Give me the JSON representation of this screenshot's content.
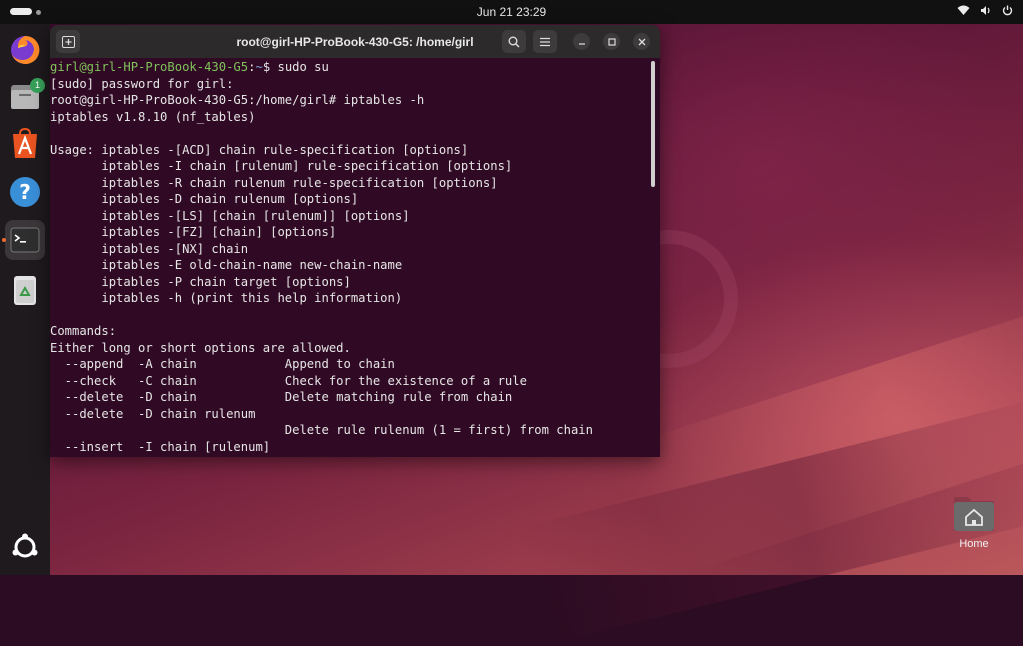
{
  "topbar": {
    "clock": "Jun 21  23:29",
    "icons": [
      "wifi-icon",
      "volume-icon",
      "power-icon"
    ]
  },
  "dock": {
    "items": [
      {
        "name": "firefox",
        "icon": "firefox-icon"
      },
      {
        "name": "files",
        "icon": "files-icon",
        "badge": "1"
      },
      {
        "name": "app-center",
        "icon": "app-center-icon"
      },
      {
        "name": "help",
        "icon": "help-icon"
      },
      {
        "name": "terminal",
        "icon": "terminal-icon",
        "active": true
      },
      {
        "name": "trash",
        "icon": "trash-icon"
      }
    ],
    "show_apps_icon": "ubuntu-logo-icon"
  },
  "terminal": {
    "title": "root@girl-HP-ProBook-430-G5: /home/girl",
    "prompt_user": "girl@girl-HP-ProBook-430-G5",
    "prompt_sep": ":",
    "prompt_path": "~",
    "prompt_cmd": "$ sudo su",
    "lines": [
      "[sudo] password for girl:",
      "root@girl-HP-ProBook-430-G5:/home/girl# iptables -h",
      "iptables v1.8.10 (nf_tables)",
      "",
      "Usage: iptables -[ACD] chain rule-specification [options]",
      "       iptables -I chain [rulenum] rule-specification [options]",
      "       iptables -R chain rulenum rule-specification [options]",
      "       iptables -D chain rulenum [options]",
      "       iptables -[LS] [chain [rulenum]] [options]",
      "       iptables -[FZ] [chain] [options]",
      "       iptables -[NX] chain",
      "       iptables -E old-chain-name new-chain-name",
      "       iptables -P chain target [options]",
      "       iptables -h (print this help information)",
      "",
      "Commands:",
      "Either long or short options are allowed.",
      "  --append  -A chain            Append to chain",
      "  --check   -C chain            Check for the existence of a rule",
      "  --delete  -D chain            Delete matching rule from chain",
      "  --delete  -D chain rulenum",
      "                                Delete rule rulenum (1 = first) from chain",
      "  --insert  -I chain [rulenum]"
    ]
  },
  "desktop": {
    "home_label": "Home"
  }
}
